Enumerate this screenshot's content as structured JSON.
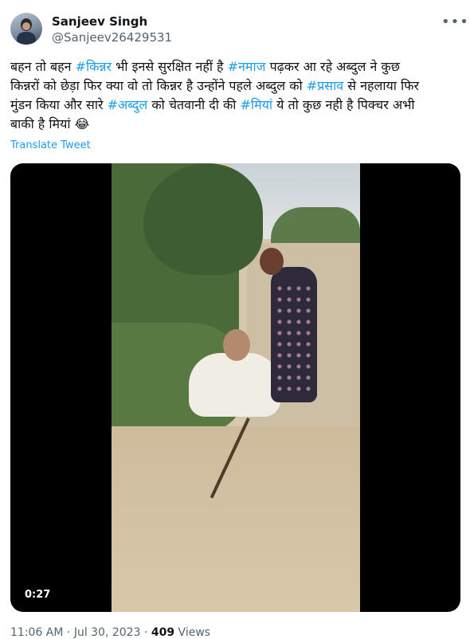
{
  "author": {
    "name": "Sanjeev Singh",
    "handle": "@Sanjeev26429531"
  },
  "tweet": {
    "segments": [
      {
        "text": "बहन तो बहन ",
        "hashtag": false
      },
      {
        "text": "#किन्नर",
        "hashtag": true
      },
      {
        "text": " भी इनसे सुरक्षित नहीं है ",
        "hashtag": false
      },
      {
        "text": "#नमाज",
        "hashtag": true
      },
      {
        "text": " पढ़कर आ रहे अब्दुल ने कुछ\nकिन्नरों को छेड़ा फिर क्या वो तो किन्नर है उन्होंने पहले अब्दुल को  ",
        "hashtag": false
      },
      {
        "text": "#प्रसाव",
        "hashtag": true
      },
      {
        "text": " से नहलाया फिर\nमुंडन किया और सारे ",
        "hashtag": false
      },
      {
        "text": "#अब्दुल",
        "hashtag": true
      },
      {
        "text": " को चेतवानी दी की ",
        "hashtag": false
      },
      {
        "text": "#मियां",
        "hashtag": true
      },
      {
        "text": " ये तो कुछ नही है पिक्चर अभी\nबाकी है मियां 😂",
        "hashtag": false
      }
    ],
    "translate_label": "Translate Tweet"
  },
  "video": {
    "duration": "0:27"
  },
  "meta": {
    "time": "11:06 AM",
    "separator": "·",
    "date": "Jul 30, 2023",
    "views_count": "409",
    "views_label": "Views"
  },
  "colors": {
    "link": "#1d9bf0",
    "text": "#0f1419",
    "secondary": "#536471"
  },
  "icons": {
    "more": "more-dots-icon"
  }
}
